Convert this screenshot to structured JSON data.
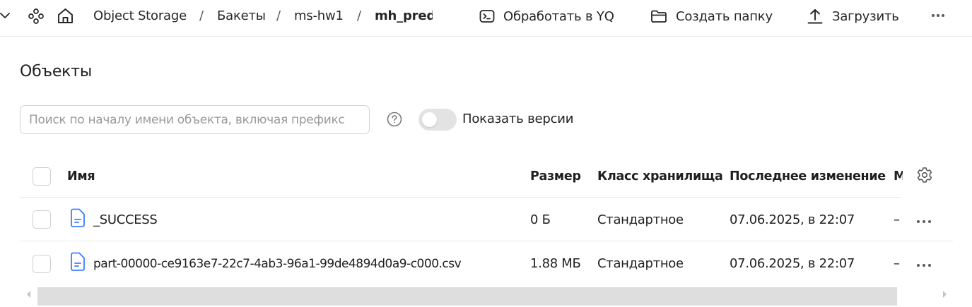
{
  "topbar": {
    "breadcrumbs": [
      {
        "label": "Object Storage"
      },
      {
        "label": "Бакеты"
      },
      {
        "label": "ms-hw1"
      },
      {
        "label": "mh_predi"
      }
    ],
    "separator": "/",
    "actions": {
      "process_yq": "Обработать в YQ",
      "create_folder": "Создать папку",
      "upload": "Загрузить"
    }
  },
  "page": {
    "title": "Объекты"
  },
  "search": {
    "placeholder": "Поиск по началу имени объекта, включая префикс",
    "value": ""
  },
  "versions_toggle": {
    "label": "Показать версии",
    "enabled": false
  },
  "table": {
    "columns": {
      "name": "Имя",
      "size": "Размер",
      "storage_class": "Класс хранилища",
      "modified": "Последнее изменение",
      "truncated": "М"
    },
    "rows": [
      {
        "name": "_SUCCESS",
        "size": "0 Б",
        "storage_class": "Стандартное",
        "modified": "07.06.2025, в 22:07",
        "extra": "–"
      },
      {
        "name": "part-00000-ce9163e7-22c7-4ab3-96a1-99de4894d0a9-c000.csv",
        "size": "1.88 МБ",
        "storage_class": "Стандартное",
        "modified": "07.06.2025, в 22:07",
        "extra": "–"
      }
    ]
  },
  "colors": {
    "file_icon": "#3d7dff",
    "border": "#e8e8e8",
    "placeholder": "#9a9a9a",
    "toggle_off": "#e3e3e3",
    "scroll_thumb": "#dedede"
  }
}
